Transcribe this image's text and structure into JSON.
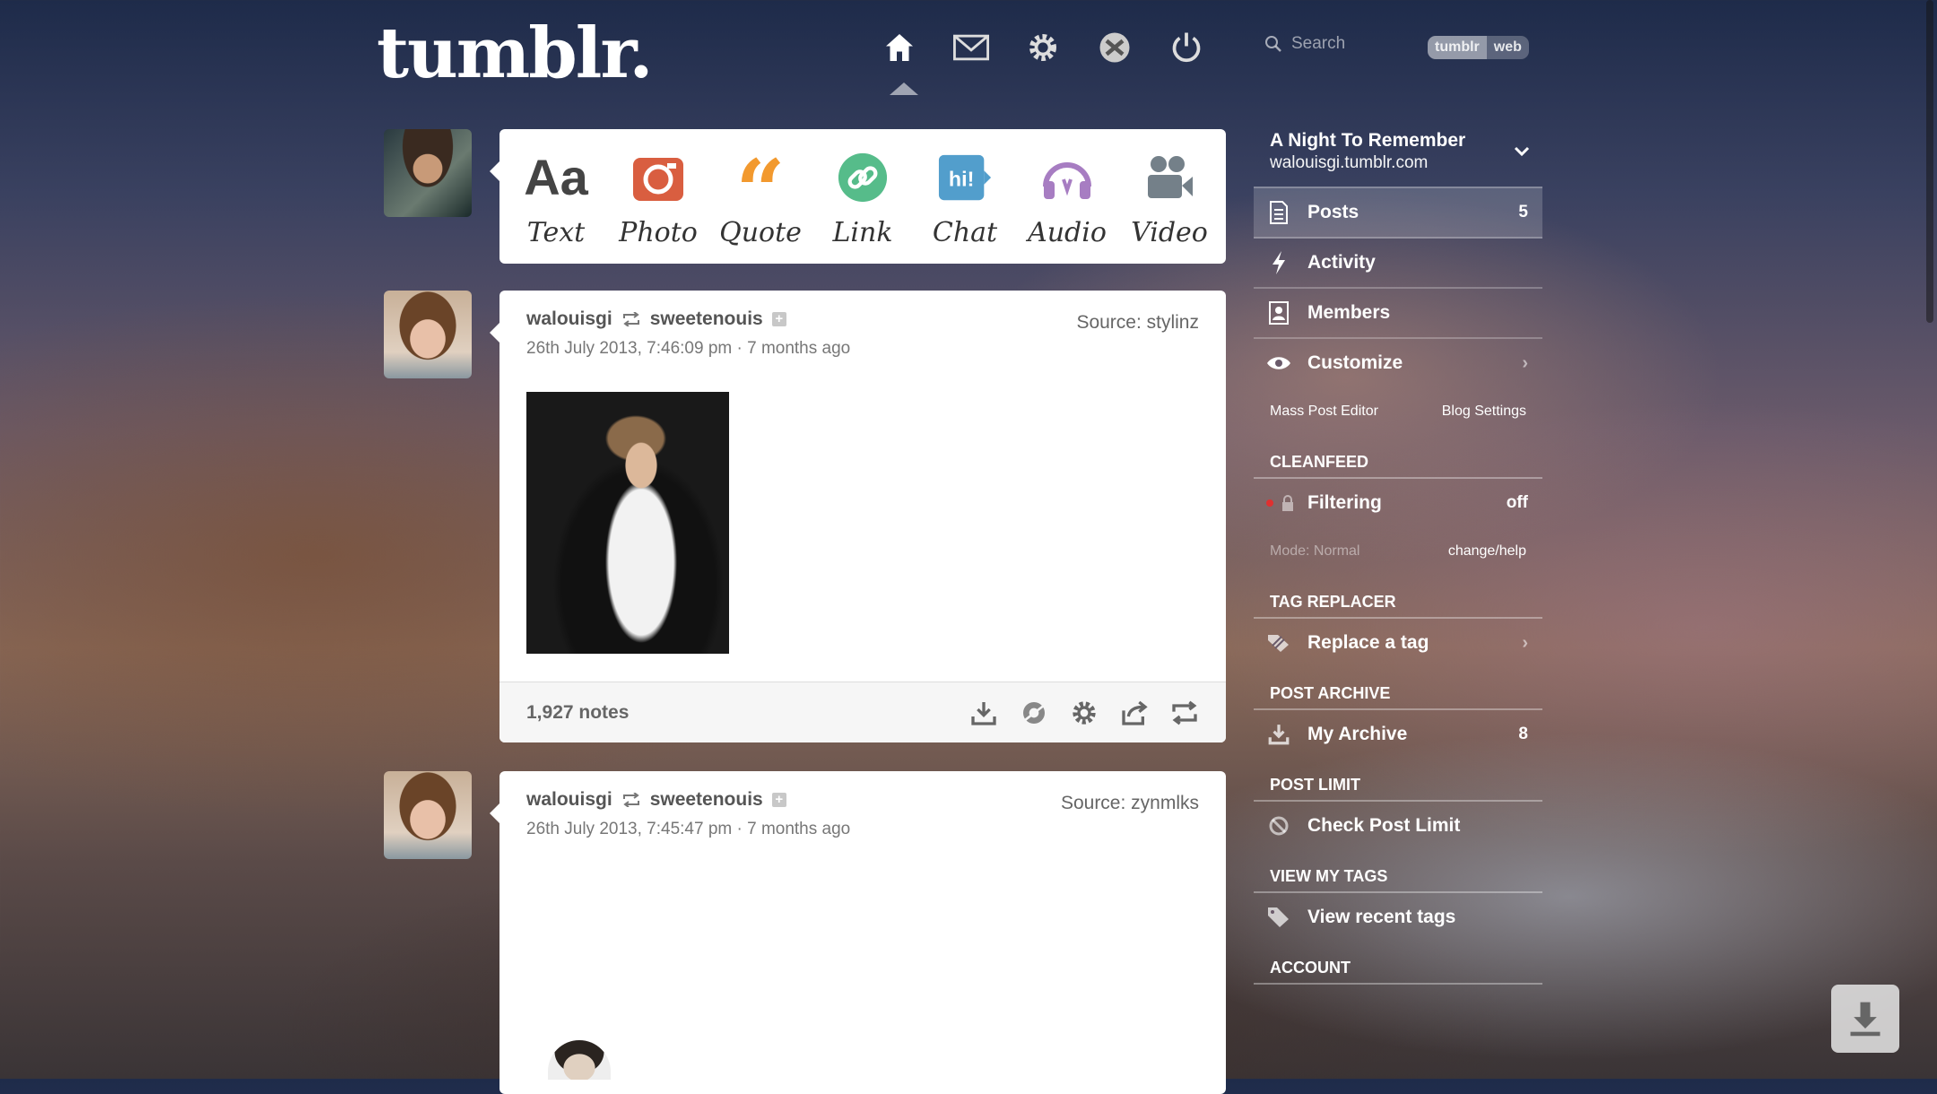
{
  "header": {
    "logo_text": "tumblr.",
    "nav_icons": [
      "home-icon",
      "mail-icon",
      "gear-icon",
      "xkit-icon",
      "power-icon"
    ],
    "search": {
      "placeholder": "Search",
      "toggle": [
        "tumblr",
        "web"
      ],
      "selected": "tumblr"
    }
  },
  "post_types": [
    {
      "label": "Text",
      "icon": "text-icon",
      "color": "#444444"
    },
    {
      "label": "Photo",
      "icon": "camera-icon",
      "color": "#d95e40"
    },
    {
      "label": "Quote",
      "icon": "quote-icon",
      "color": "#f2992e"
    },
    {
      "label": "Link",
      "icon": "link-icon",
      "color": "#56bc8a"
    },
    {
      "label": "Chat",
      "icon": "chat-icon",
      "color": "#529ecc"
    },
    {
      "label": "Audio",
      "icon": "headphones-icon",
      "color": "#a77dc2"
    },
    {
      "label": "Video",
      "icon": "video-icon",
      "color": "#748089"
    }
  ],
  "posts": [
    {
      "author": "walouisgi",
      "reblogged_from": "sweetenouis",
      "date": "26th July 2013, 7:46:09 pm · 7 months ago",
      "source": "Source: stylinz",
      "notes": "1,927 notes"
    },
    {
      "author": "walouisgi",
      "reblogged_from": "sweetenouis",
      "date": "26th July 2013, 7:45:47 pm · 7 months ago",
      "source": "Source: zynmlks"
    }
  ],
  "sidebar": {
    "blog_title": "A Night To Remember",
    "blog_url": "walouisgi.tumblr.com",
    "items": [
      {
        "label": "Posts",
        "count": "5"
      },
      {
        "label": "Activity"
      },
      {
        "label": "Members"
      },
      {
        "label": "Customize"
      }
    ],
    "sub_links": [
      "Mass Post Editor",
      "Blog Settings"
    ],
    "cleanfeed": {
      "heading": "CLEANFEED",
      "filtering_label": "Filtering",
      "filtering_value": "off",
      "mode": "Mode: Normal",
      "change": "change/help"
    },
    "tag_replacer": {
      "heading": "TAG REPLACER",
      "label": "Replace a tag"
    },
    "post_archive": {
      "heading": "POST ARCHIVE",
      "label": "My Archive",
      "count": "8"
    },
    "post_limit": {
      "heading": "POST LIMIT",
      "label": "Check Post Limit"
    },
    "view_tags": {
      "heading": "VIEW MY TAGS",
      "label": "View recent tags"
    },
    "account": {
      "heading": "ACCOUNT"
    }
  }
}
